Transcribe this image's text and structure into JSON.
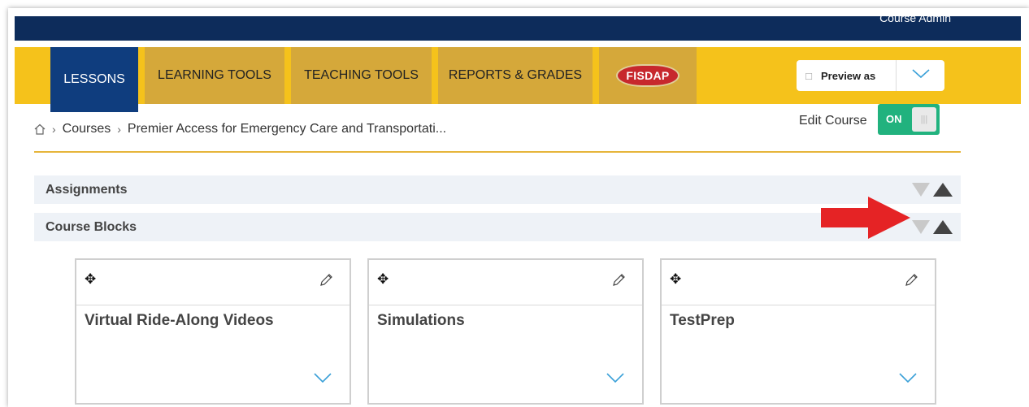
{
  "header": {
    "admin_label": "Course Admin"
  },
  "nav": {
    "tabs": [
      "LESSONS",
      "LEARNING TOOLS",
      "TEACHING TOOLS",
      "REPORTS & GRADES"
    ],
    "fisdap_label": "FISDAP",
    "preview_label": "Preview as"
  },
  "breadcrumb": {
    "courses": "Courses",
    "course": "Premier Access for Emergency Care and Transportati..."
  },
  "edit_course": {
    "label": "Edit Course",
    "toggle_text": "ON"
  },
  "sections": [
    "Assignments",
    "Course Blocks"
  ],
  "cards": [
    "Virtual Ride-Along Videos",
    "Simulations",
    "TestPrep"
  ],
  "colors": {
    "navy": "#0d2c5b",
    "gold": "#f5c21b",
    "tab": "#d5a83a",
    "active_tab": "#0f3d7e",
    "green": "#21b27e",
    "red_arrow": "#e52325"
  }
}
